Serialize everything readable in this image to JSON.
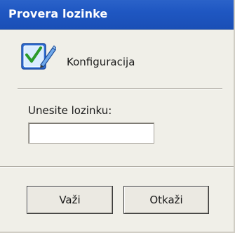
{
  "window": {
    "title": "Provera lozinke"
  },
  "header": {
    "icon": "configuration-checkmark-icon",
    "label": "Konfiguracija"
  },
  "form": {
    "prompt_label": "Unesite lozinku:",
    "password_value": ""
  },
  "buttons": {
    "ok_label": "Važi",
    "cancel_label": "Otkaži"
  },
  "colors": {
    "titlebar": "#1f57c2",
    "window_bg": "#f0efe8",
    "title_text": "#ffffff"
  }
}
